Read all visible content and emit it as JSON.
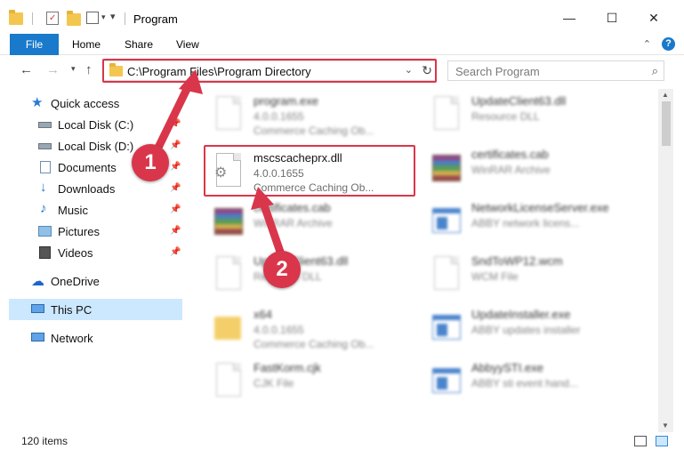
{
  "window": {
    "title": "Program",
    "minimize": "—",
    "maximize": "☐",
    "close": "✕"
  },
  "ribbon": {
    "tabs": [
      "File",
      "Home",
      "Share",
      "View"
    ],
    "collapse": "⌃",
    "help": "?"
  },
  "address": {
    "path": "C:\\Program Files\\Program Directory",
    "dropdown": "⌄",
    "refresh": "↻"
  },
  "search": {
    "placeholder": "Search Program"
  },
  "sidebar": {
    "quick_access": "Quick access",
    "items": [
      {
        "label": "Local Disk (C:)",
        "icon": "drive-icon",
        "pinned": true
      },
      {
        "label": "Local Disk (D:)",
        "icon": "drive-icon",
        "pinned": true
      },
      {
        "label": "Documents",
        "icon": "documents-icon",
        "pinned": true
      },
      {
        "label": "Downloads",
        "icon": "downloads-icon",
        "pinned": true
      },
      {
        "label": "Music",
        "icon": "music-icon",
        "pinned": true
      },
      {
        "label": "Pictures",
        "icon": "pictures-icon",
        "pinned": true
      },
      {
        "label": "Videos",
        "icon": "videos-icon",
        "pinned": true
      }
    ],
    "onedrive": "OneDrive",
    "this_pc": "This PC",
    "network": "Network"
  },
  "files": {
    "left": [
      {
        "name": "program.exe",
        "version": "4.0.0.1655",
        "desc": "Commerce Caching Ob...",
        "icon": "exe-icon"
      },
      {
        "name": "mscscacheprx.dll",
        "version": "4.0.0.1655",
        "desc": "Commerce Caching Ob...",
        "icon": "dll-gear-icon"
      },
      {
        "name": "certificates.cab",
        "version": "",
        "desc": "WinRAR Archive",
        "icon": "winrar-icon"
      },
      {
        "name": "UpdateClient63.dll",
        "version": "",
        "desc": "Resource DLL",
        "icon": "dll-icon"
      },
      {
        "name": "x64",
        "version": "4.0.0.1655",
        "desc": "Commerce Caching Ob...",
        "icon": "folder-icon"
      },
      {
        "name": "FastKorm.cjk",
        "version": "",
        "desc": "CJK File",
        "icon": "file-icon"
      }
    ],
    "right": [
      {
        "name": "UpdateClient63.dll",
        "version": "",
        "desc": "Resource DLL",
        "icon": "dll-icon"
      },
      {
        "name": "certificates.cab",
        "version": "",
        "desc": "WinRAR Archive",
        "icon": "winrar-icon"
      },
      {
        "name": "NetworkLicenseServer.exe",
        "version": "",
        "desc": "ABBY network licens...",
        "icon": "app-window-icon"
      },
      {
        "name": "SndToWP12.wcm",
        "version": "",
        "desc": "WCM File",
        "icon": "file-icon"
      },
      {
        "name": "UpdateInstaller.exe",
        "version": "",
        "desc": "ABBY updates installer",
        "icon": "app-window-icon"
      },
      {
        "name": "AbbyySTI.exe",
        "version": "",
        "desc": "ABBY sti event hand...",
        "icon": "app-window-icon"
      }
    ]
  },
  "status": {
    "count": "120 items"
  },
  "annotations": {
    "step1": "1",
    "step2": "2",
    "color": "#d9364b"
  }
}
